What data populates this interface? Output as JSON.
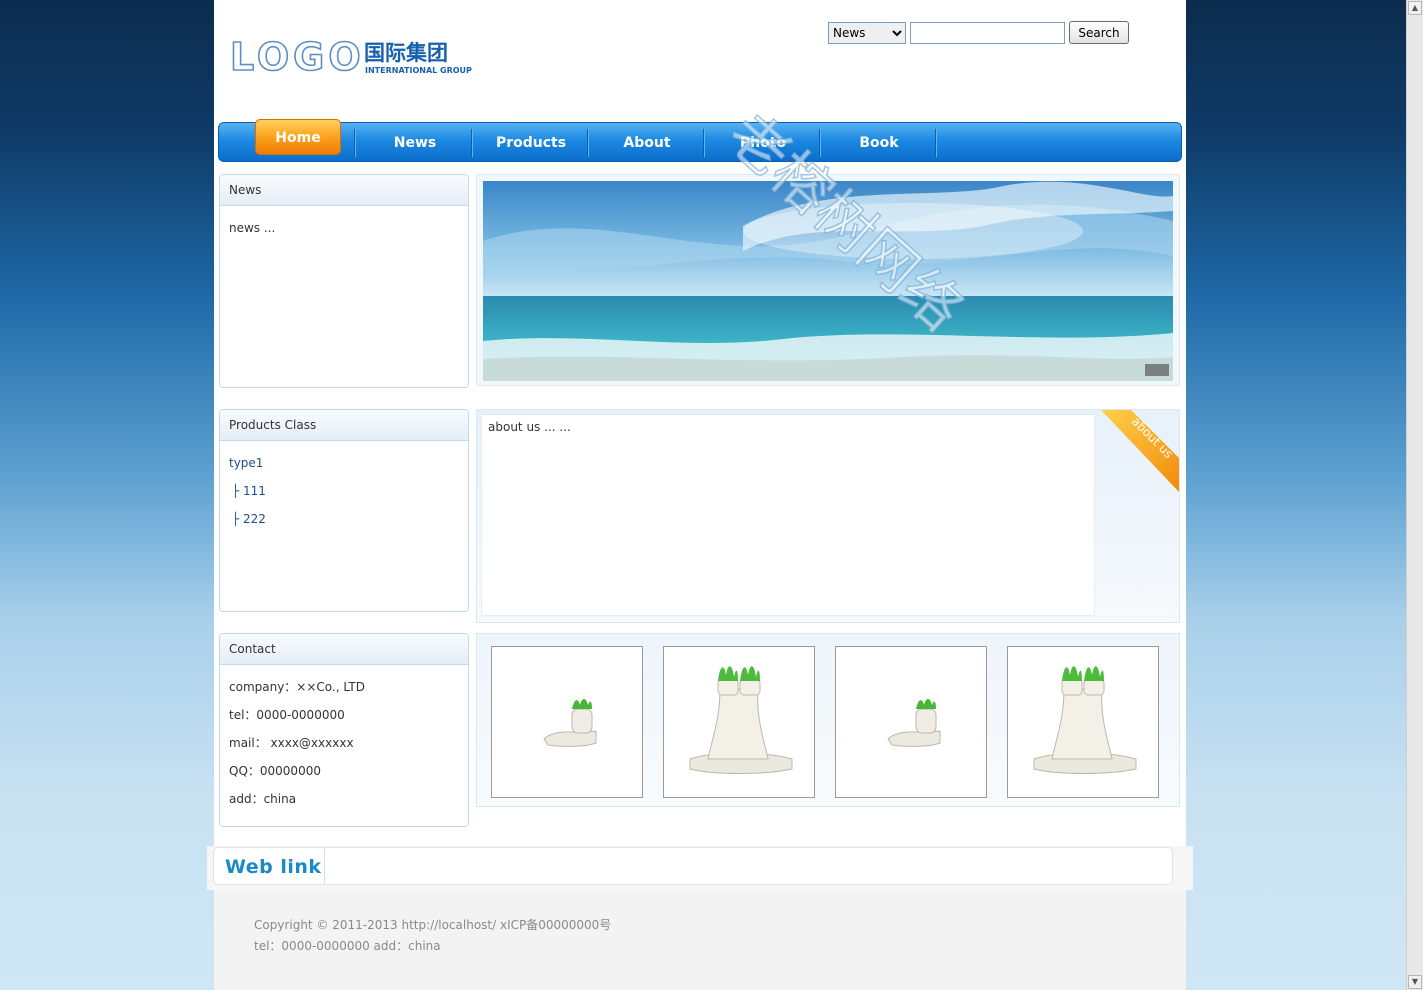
{
  "header": {
    "logo": {
      "mark": "LOGO",
      "cn": "国际集团",
      "en": "INTERNATIONAL GROUP"
    },
    "search": {
      "category_selected": "News",
      "query_value": "",
      "button_label": "Search"
    }
  },
  "nav": {
    "items": [
      {
        "label": "Home",
        "active": true
      },
      {
        "label": "News"
      },
      {
        "label": "Products"
      },
      {
        "label": "About"
      },
      {
        "label": "Photo"
      },
      {
        "label": "Book"
      }
    ]
  },
  "sidebar": {
    "news": {
      "title": "News",
      "items": [
        "news ..."
      ]
    },
    "products_class": {
      "title": "Products Class",
      "type": "type1",
      "subitems": [
        "├ 111",
        "├ 222"
      ]
    },
    "contact": {
      "title": "Contact",
      "company": "company：××Co., LTD",
      "tel": "tel：0000-0000000",
      "mail": "mail：  xxxx@xxxxxx",
      "qq": "QQ：00000000",
      "add": "add：china"
    }
  },
  "main": {
    "about": {
      "text": "about us ... ...",
      "ribbon": "about us"
    },
    "gallery": {
      "thumb_count": 4
    }
  },
  "weblink": {
    "title": "Web  link"
  },
  "footer": {
    "line1": "Copyright © 2011-2013 http://localhost/ xICP备00000000号",
    "line2": "tel：0000-0000000 add：china"
  },
  "watermark": "老榕树网络",
  "colors": {
    "nav_blue": "#1d89e2",
    "home_orange": "#fb9d18",
    "link_blue": "#1a8ac9"
  }
}
